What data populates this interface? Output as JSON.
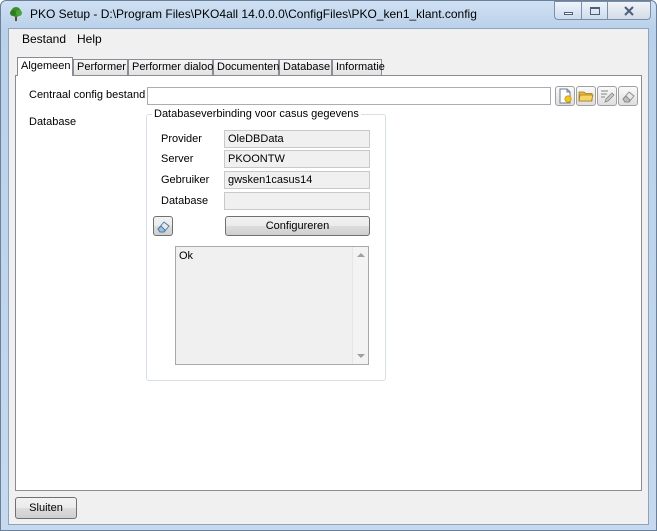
{
  "window": {
    "title": "PKO Setup - D:\\Program Files\\PKO4all 14.0.0.0\\ConfigFiles\\PKO_ken1_klant.config"
  },
  "menu": [
    "Bestand",
    "Help"
  ],
  "tabs": [
    "Algemeen",
    "Performer",
    "Performer dialoog",
    "Documenten",
    "Database",
    "Informatie"
  ],
  "algemeen": {
    "central_config_label": "Centraal config bestand",
    "central_config_value": "",
    "database_label": "Database",
    "group_title": "Databaseverbinding voor casus gegevens",
    "fields": {
      "provider_label": "Provider",
      "provider_value": "OleDBData",
      "server_label": "Server",
      "server_value": "PKOONTW",
      "user_label": "Gebruiker",
      "user_value": "gwsken1casus14",
      "database_label": "Database",
      "database_value": ""
    },
    "configure_label": "Configureren",
    "status_text": "Ok"
  },
  "footer": {
    "close_label": "Sluiten"
  },
  "icons": {
    "app": "tree-icon",
    "new_file": "new-file-icon",
    "open_folder": "open-folder-icon",
    "edit": "edit-icon",
    "eraser": "eraser-icon"
  }
}
